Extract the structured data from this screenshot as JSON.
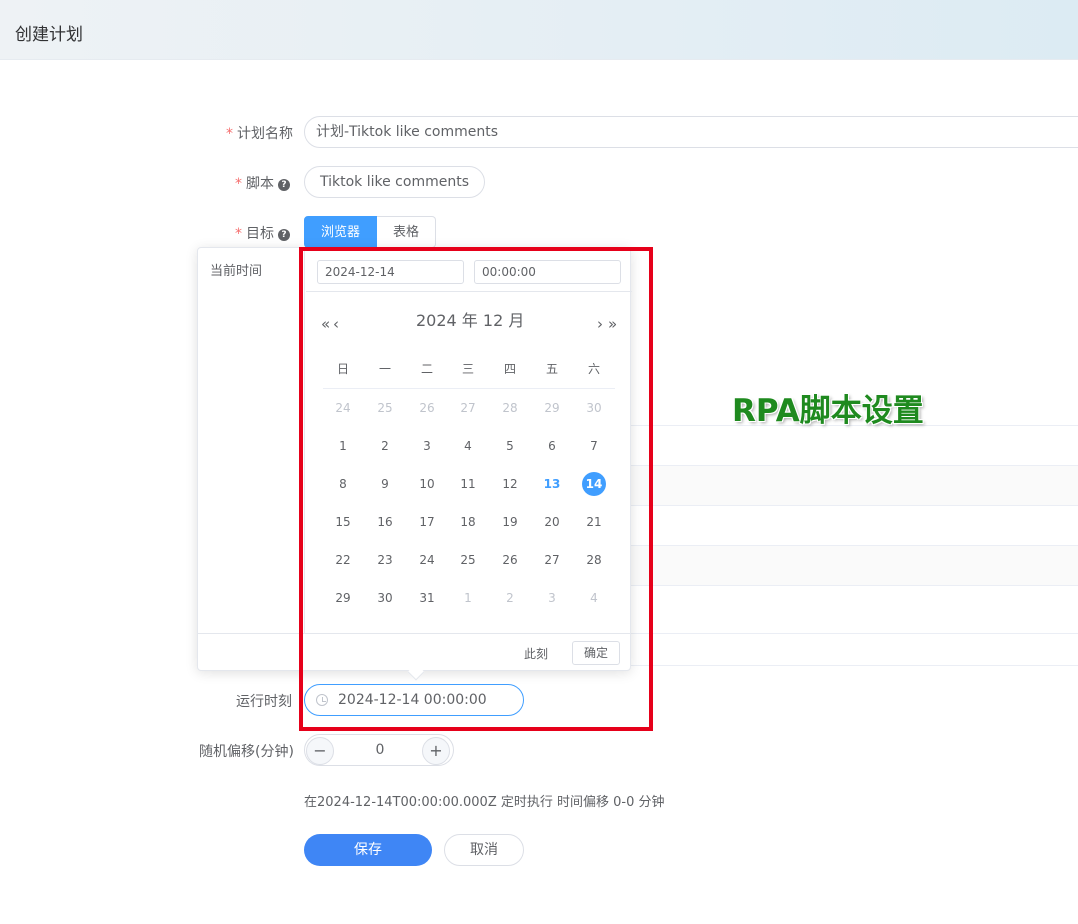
{
  "header": {
    "title": "创建计划"
  },
  "form": {
    "plan_name": {
      "label": "计划名称",
      "value": "计划-Tiktok like comments"
    },
    "script": {
      "label": "脚本",
      "value": "Tiktok like comments",
      "help_icon": "question-circle-icon"
    },
    "target": {
      "label": "目标",
      "help_icon": "question-circle-icon",
      "options": [
        "浏览器",
        "表格"
      ],
      "selected": "浏览器"
    },
    "run_time": {
      "label": "运行时刻",
      "value": "2024-12-14 00:00:00",
      "icon": "clock-icon"
    },
    "random_offset": {
      "label": "随机偏移(分钟)",
      "value": "0",
      "minus": "−",
      "plus": "+"
    },
    "summary": "在2024-12-14T00:00:00.000Z 定时执行 时间偏移 0-0 分钟",
    "save_label": "保存",
    "cancel_label": "取消"
  },
  "overlay_caption": "RPA脚本设置",
  "picker": {
    "shortcut": "当前时间",
    "date_input": "2024-12-14",
    "time_input": "00:00:00",
    "prev_year": "«",
    "prev_month": "‹",
    "next_month": "›",
    "next_year": "»",
    "title": "2024 年  12 月",
    "weekdays": [
      "日",
      "一",
      "二",
      "三",
      "四",
      "五",
      "六"
    ],
    "weeks": [
      [
        "24",
        "25",
        "26",
        "27",
        "28",
        "29",
        "30"
      ],
      [
        "1",
        "2",
        "3",
        "4",
        "5",
        "6",
        "7"
      ],
      [
        "8",
        "9",
        "10",
        "11",
        "12",
        "13",
        "14"
      ],
      [
        "15",
        "16",
        "17",
        "18",
        "19",
        "20",
        "21"
      ],
      [
        "22",
        "23",
        "24",
        "25",
        "26",
        "27",
        "28"
      ],
      [
        "29",
        "30",
        "31",
        "1",
        "2",
        "3",
        "4"
      ]
    ],
    "today": "13",
    "selected": "14",
    "now_label": "此刻",
    "confirm_label": "确定"
  },
  "colors": {
    "primary": "#409eff",
    "required": "#f56c6c",
    "highlight_frame": "#e6001a",
    "caption": "#1f8a1f"
  }
}
